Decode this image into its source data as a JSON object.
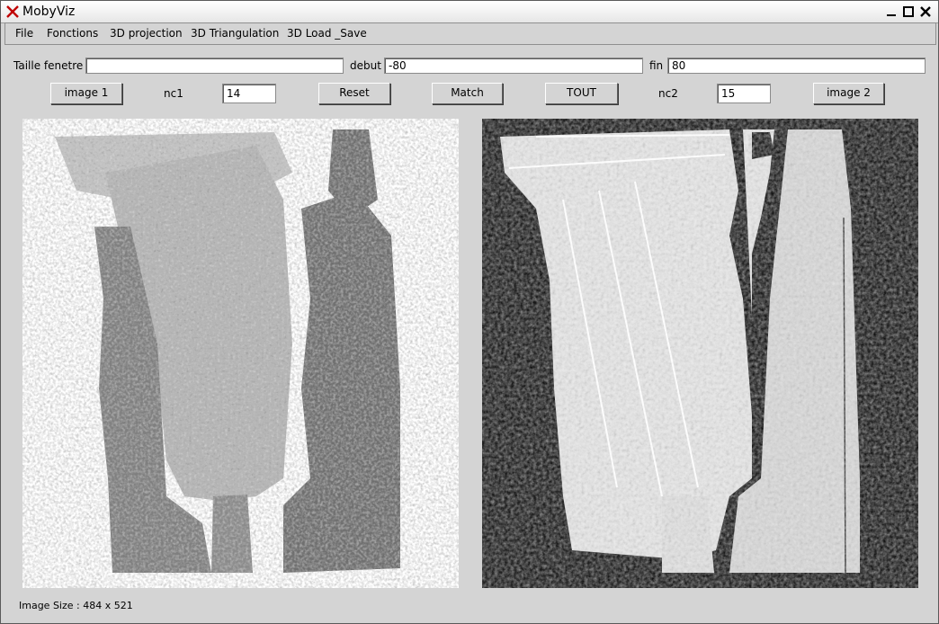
{
  "window": {
    "title": "MobyViz"
  },
  "menu": [
    "File",
    "Fonctions",
    "3D projection",
    "3D Triangulation",
    "3D Load _Save"
  ],
  "toolbar": {
    "taille_label": "Taille fenetre",
    "taille_value": "",
    "debut_label": "debut",
    "debut_value": "-80",
    "fin_label": "fin",
    "fin_value": "80"
  },
  "buttons": {
    "image1": "image 1",
    "nc1_label": "nc1",
    "nc1_value": "14",
    "reset": "Reset",
    "match": "Match",
    "tout": "TOUT",
    "nc2_label": "nc2",
    "nc2_value": "15",
    "image2": "image 2"
  },
  "status": "Image Size : 484 x 521",
  "colors": {
    "left_bg": "#ffffff",
    "right_bg": "#000000",
    "chrome": "#d4d4d4"
  }
}
